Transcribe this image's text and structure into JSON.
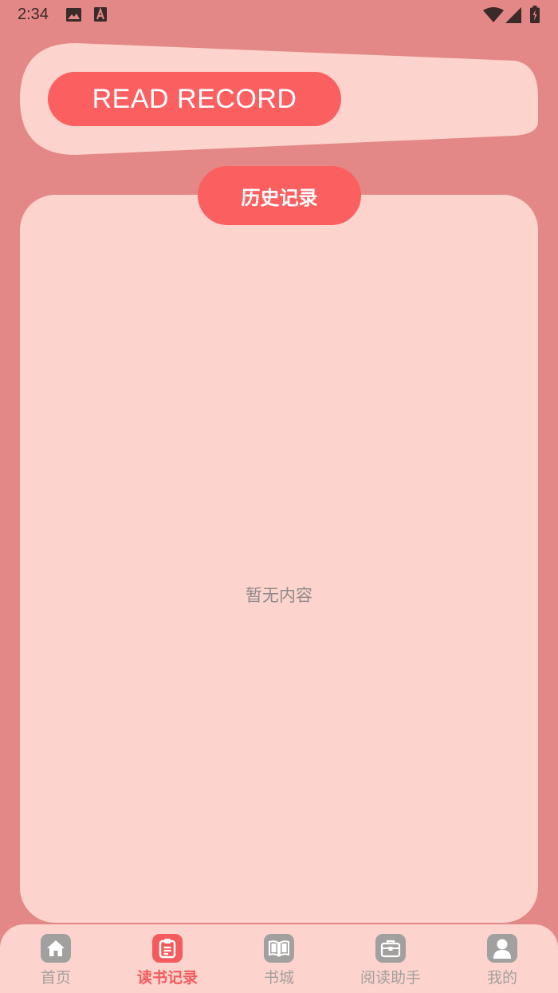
{
  "status_bar": {
    "time": "2:34",
    "icons": [
      "image-icon",
      "font-a-icon",
      "wifi-icon",
      "cell-signal-icon",
      "battery-icon"
    ]
  },
  "header": {
    "banner_label": "READ RECORD"
  },
  "content": {
    "tab_label": "历史记录",
    "empty_message": "暂无内容"
  },
  "bottom_nav": {
    "items": [
      {
        "label": "首页",
        "icon": "home-icon",
        "active": false
      },
      {
        "label": "读书记录",
        "icon": "clipboard-icon",
        "active": true
      },
      {
        "label": "书城",
        "icon": "book-icon",
        "active": false
      },
      {
        "label": "阅读助手",
        "icon": "toolbox-icon",
        "active": false
      },
      {
        "label": "我的",
        "icon": "user-icon",
        "active": false
      }
    ]
  },
  "colors": {
    "background": "#e38886",
    "card": "#fdd4cd",
    "accent": "#fc5f60",
    "inactive_icon": "#a2a09f",
    "inactive_text": "#a39f9e"
  }
}
